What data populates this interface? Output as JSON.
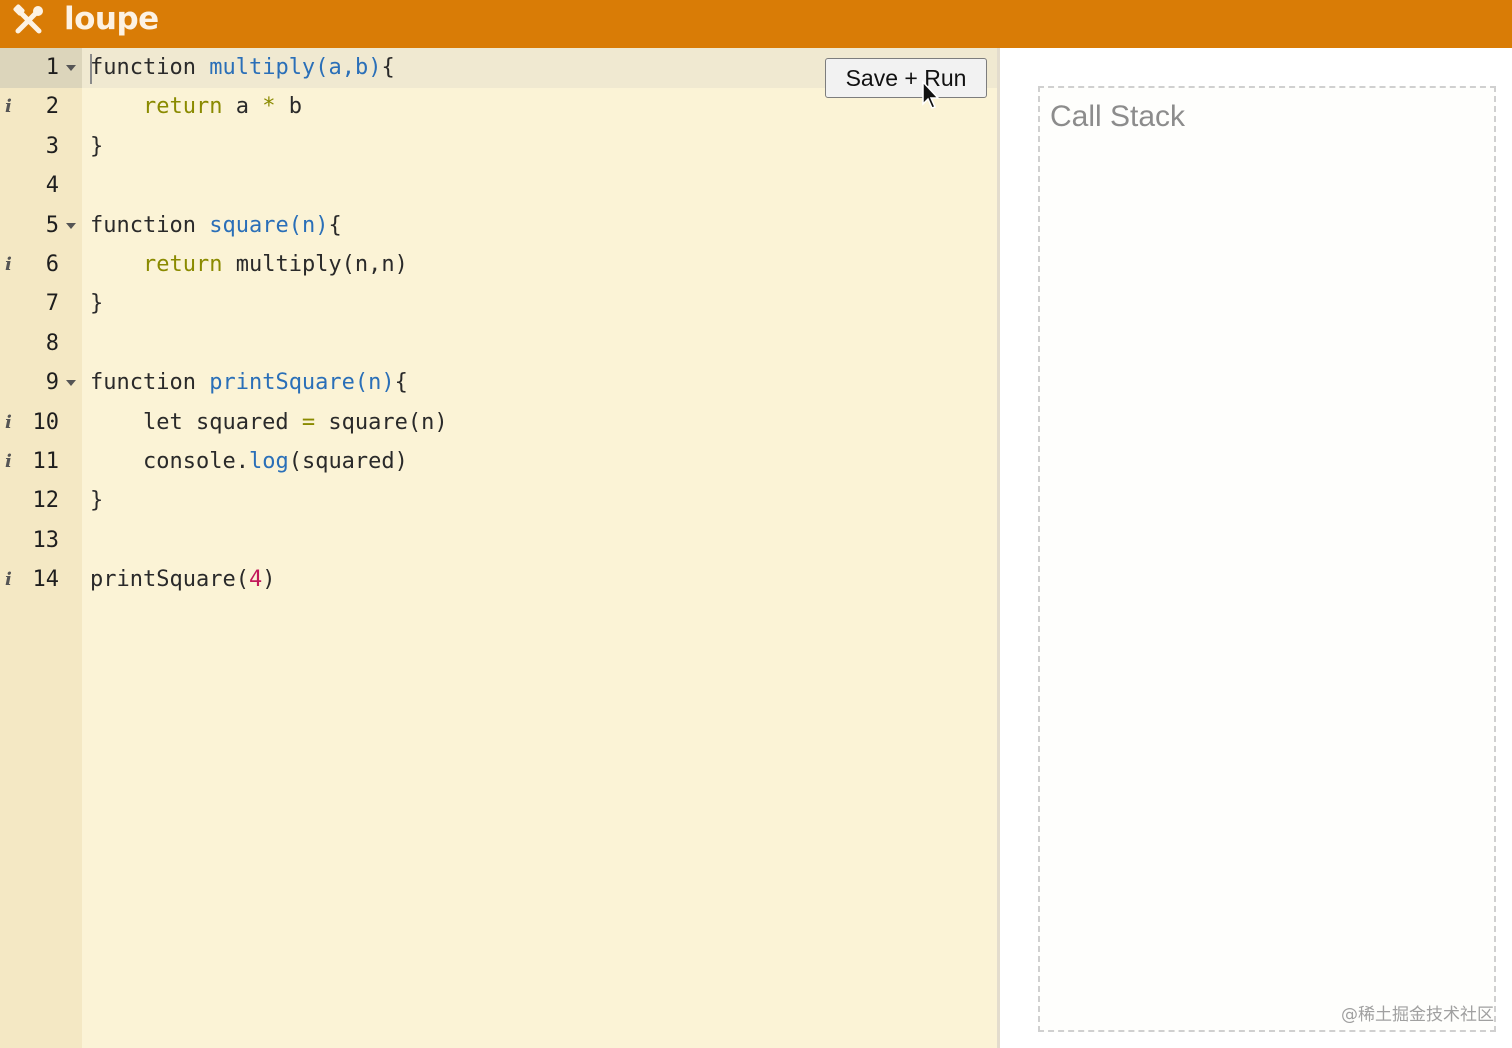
{
  "app": {
    "title": "loupe",
    "logo_icon": "tools-icon",
    "topbar_color": "#d97c06"
  },
  "editor": {
    "lines": [
      {
        "number": "1",
        "fold": true,
        "info": false,
        "active": true,
        "tokens": [
          [
            "kw",
            "function "
          ],
          [
            "fn",
            "multiply"
          ],
          [
            "pr",
            "("
          ],
          [
            "pr",
            "a"
          ],
          [
            "pr",
            ","
          ],
          [
            "pr",
            "b"
          ],
          [
            "pr",
            ")"
          ],
          [
            "kw",
            "{"
          ]
        ]
      },
      {
        "number": "2",
        "fold": false,
        "info": true,
        "tokens": [
          [
            "kw",
            "    "
          ],
          [
            "kw2",
            "return"
          ],
          [
            "kw",
            " a "
          ],
          [
            "op",
            "*"
          ],
          [
            "kw",
            " b"
          ]
        ]
      },
      {
        "number": "3",
        "fold": false,
        "info": false,
        "tokens": [
          [
            "kw",
            "}"
          ]
        ]
      },
      {
        "number": "4",
        "fold": false,
        "info": false,
        "tokens": []
      },
      {
        "number": "5",
        "fold": true,
        "info": false,
        "tokens": [
          [
            "kw",
            "function "
          ],
          [
            "fn",
            "square"
          ],
          [
            "pr",
            "("
          ],
          [
            "pr",
            "n"
          ],
          [
            "pr",
            ")"
          ],
          [
            "kw",
            "{"
          ]
        ]
      },
      {
        "number": "6",
        "fold": false,
        "info": true,
        "tokens": [
          [
            "kw",
            "    "
          ],
          [
            "kw2",
            "return"
          ],
          [
            "kw",
            " multiply(n,n)"
          ]
        ]
      },
      {
        "number": "7",
        "fold": false,
        "info": false,
        "tokens": [
          [
            "kw",
            "}"
          ]
        ]
      },
      {
        "number": "8",
        "fold": false,
        "info": false,
        "tokens": []
      },
      {
        "number": "9",
        "fold": true,
        "info": false,
        "tokens": [
          [
            "kw",
            "function "
          ],
          [
            "fn",
            "printSquare"
          ],
          [
            "pr",
            "("
          ],
          [
            "pr",
            "n"
          ],
          [
            "pr",
            ")"
          ],
          [
            "kw",
            "{"
          ]
        ]
      },
      {
        "number": "10",
        "fold": false,
        "info": true,
        "tokens": [
          [
            "kw",
            "    let squared "
          ],
          [
            "op",
            "="
          ],
          [
            "kw",
            " square(n)"
          ]
        ]
      },
      {
        "number": "11",
        "fold": false,
        "info": true,
        "tokens": [
          [
            "kw",
            "    console."
          ],
          [
            "fn",
            "log"
          ],
          [
            "kw",
            "(squared)"
          ]
        ]
      },
      {
        "number": "12",
        "fold": false,
        "info": false,
        "tokens": [
          [
            "kw",
            "}"
          ]
        ]
      },
      {
        "number": "13",
        "fold": false,
        "info": false,
        "tokens": []
      },
      {
        "number": "14",
        "fold": false,
        "info": true,
        "tokens": [
          [
            "kw",
            "printSquare("
          ],
          [
            "num",
            "4"
          ],
          [
            "kw",
            ")"
          ]
        ]
      }
    ]
  },
  "toolbar": {
    "run_label": "Save + Run"
  },
  "callstack": {
    "title": "Call Stack"
  },
  "watermark": "@稀土掘金技术社区"
}
